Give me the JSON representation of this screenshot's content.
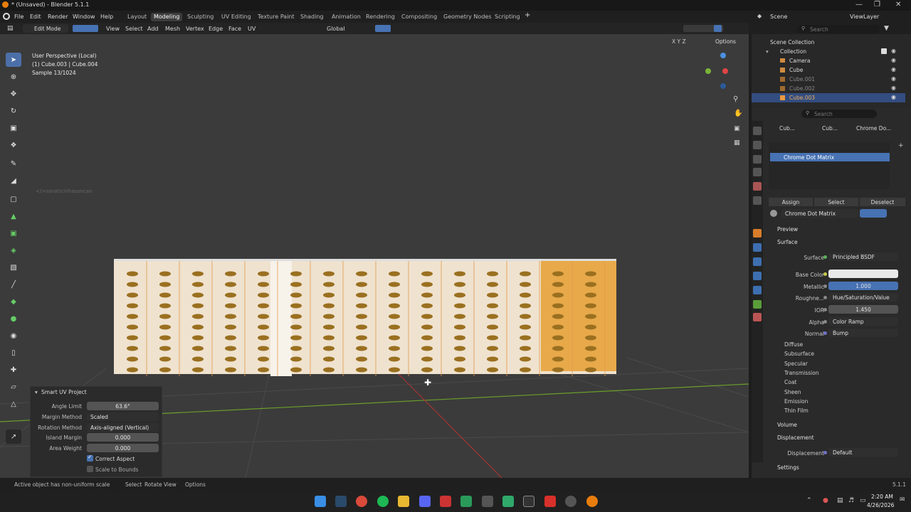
{
  "window": {
    "title": "* (Unsaved) - Blender 5.1.1",
    "minimize": "—",
    "maximize": "❐",
    "close": "✕"
  },
  "menu": [
    "File",
    "Edit",
    "Render",
    "Window",
    "Help"
  ],
  "workspaces": [
    "Layout",
    "Modeling",
    "Sculpting",
    "UV Editing",
    "Texture Paint",
    "Shading",
    "Animation",
    "Rendering",
    "Compositing",
    "Geometry Nodes",
    "Scripting"
  ],
  "active_workspace": "Modeling",
  "scene_label": "Scene",
  "viewlayer_label": "ViewLayer",
  "vp_header": {
    "mode": "Edit Mode",
    "menus": [
      "View",
      "Select",
      "Add",
      "Mesh",
      "Vertex",
      "Edge",
      "Face",
      "UV"
    ],
    "transform": "Global",
    "options": "Options",
    "axes": [
      "X",
      "Y",
      "Z"
    ]
  },
  "viewport": {
    "perspective": "User Perspective (Local)",
    "object": "(1) Cube.003 | Cube.004",
    "sample": "Sample 13/1024",
    "watermark": "</>sanaticinhasancan"
  },
  "operator": {
    "title": "Smart UV Project",
    "fields": [
      {
        "label": "Angle Limit",
        "value": "63.6°"
      },
      {
        "label": "Margin Method",
        "value": "Scaled"
      },
      {
        "label": "Rotation Method",
        "value": "Axis-aligned (Vertical)"
      },
      {
        "label": "Island Margin",
        "value": "0.000"
      },
      {
        "label": "Area Weight",
        "value": "0.000"
      }
    ],
    "checks": [
      {
        "label": "Correct Aspect",
        "checked": true
      },
      {
        "label": "Scale to Bounds",
        "checked": false
      }
    ]
  },
  "status": {
    "warning": "Active object has non-uniform scale",
    "select": "Select",
    "rotate": "Rotate View",
    "options": "Options",
    "version": "5.1.1"
  },
  "outliner": {
    "search_placeholder": "Search",
    "root": "Scene Collection",
    "collection": "Collection",
    "items": [
      "Camera",
      "Cube",
      "Cube.001",
      "Cube.002",
      "Cube.003"
    ]
  },
  "props": {
    "search_placeholder": "Search",
    "breadcrumb": [
      "Cub...",
      "Cub...",
      "Chrome Do..."
    ],
    "material_slot": "Chrome Dot Matrix",
    "assign": "Assign",
    "select": "Select",
    "deselect": "Deselect",
    "material_name": "Chrome Dot Matrix",
    "preview": "Preview",
    "surface_section": "Surface",
    "surface": {
      "label": "Surface",
      "value": "Principled BSDF"
    },
    "base_color_label": "Base Color",
    "metallic": {
      "label": "Metallic",
      "value": "1.000"
    },
    "roughness": {
      "label": "Roughne...",
      "value": "Hue/Saturation/Value"
    },
    "ior": {
      "label": "IOR",
      "value": "1.450"
    },
    "alpha": {
      "label": "Alpha",
      "value": "Color Ramp"
    },
    "normal": {
      "label": "Normal",
      "value": "Bump"
    },
    "subpanels": [
      "Diffuse",
      "Subsurface",
      "Specular",
      "Transmission",
      "Coat",
      "Sheen",
      "Emission",
      "Thin Film"
    ],
    "volume": "Volume",
    "displacement_section": "Displacement",
    "displacement": {
      "label": "Displacement",
      "value": "Default"
    },
    "settings": "Settings"
  },
  "taskbar": {
    "time": "2:20 AM",
    "date": "4/26/2026"
  },
  "colors": {
    "accent": "#4772b3",
    "selection": "#334d80",
    "mesh": "#e8b270",
    "dots": "#9a7020"
  }
}
